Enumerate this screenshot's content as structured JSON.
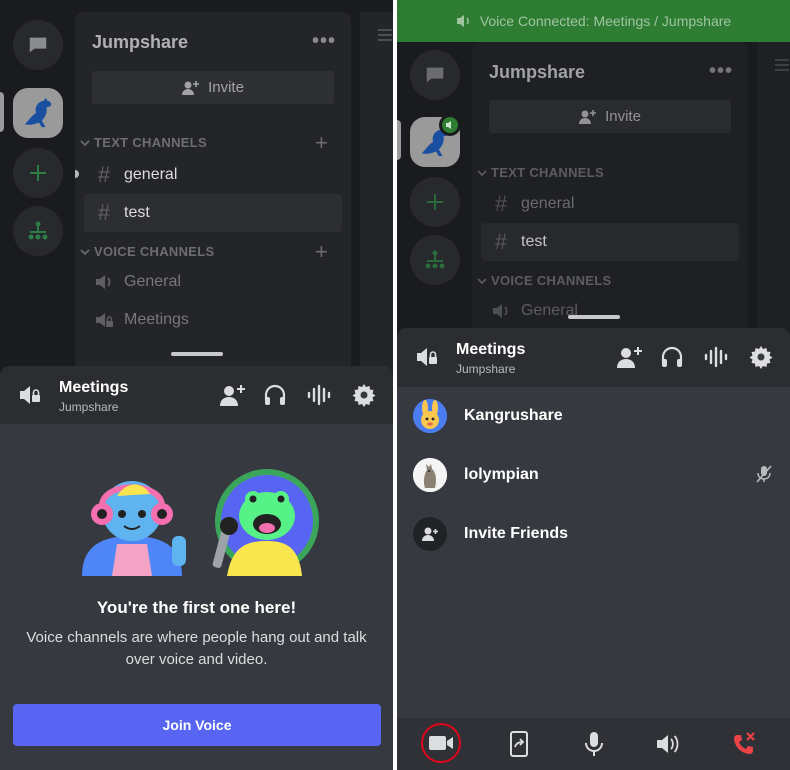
{
  "server": {
    "name": "Jumpshare",
    "invite_label": "Invite",
    "more_label": "•••"
  },
  "categories": {
    "text": "TEXT CHANNELS",
    "voice": "VOICE CHANNELS"
  },
  "text_channels": [
    "general",
    "test"
  ],
  "voice_channels": [
    "General",
    "Meetings"
  ],
  "voice_sheet": {
    "channel": "Meetings",
    "server": "Jumpshare",
    "empty_title": "You're the first one here!",
    "empty_desc": "Voice channels are where people hang out and talk over voice and video.",
    "join_label": "Join Voice"
  },
  "connected_banner": "Voice Connected: Meetings / Jumpshare",
  "members": [
    {
      "name": "Kangrushare",
      "avatar": "bunny-avatar-icon"
    },
    {
      "name": "lolympian",
      "avatar": "kangaroo-avatar-icon",
      "status": "muted"
    }
  ],
  "invite_friends_label": "Invite Friends",
  "toolbar": [
    "camera-icon",
    "screen-share-icon",
    "microphone-icon",
    "speaker-icon",
    "hang-up-icon"
  ],
  "colors": {
    "join": "#5865f2",
    "connected": "#2e7d32",
    "highlight_circle": "#e1061a",
    "hang_up": "#ed4245"
  }
}
